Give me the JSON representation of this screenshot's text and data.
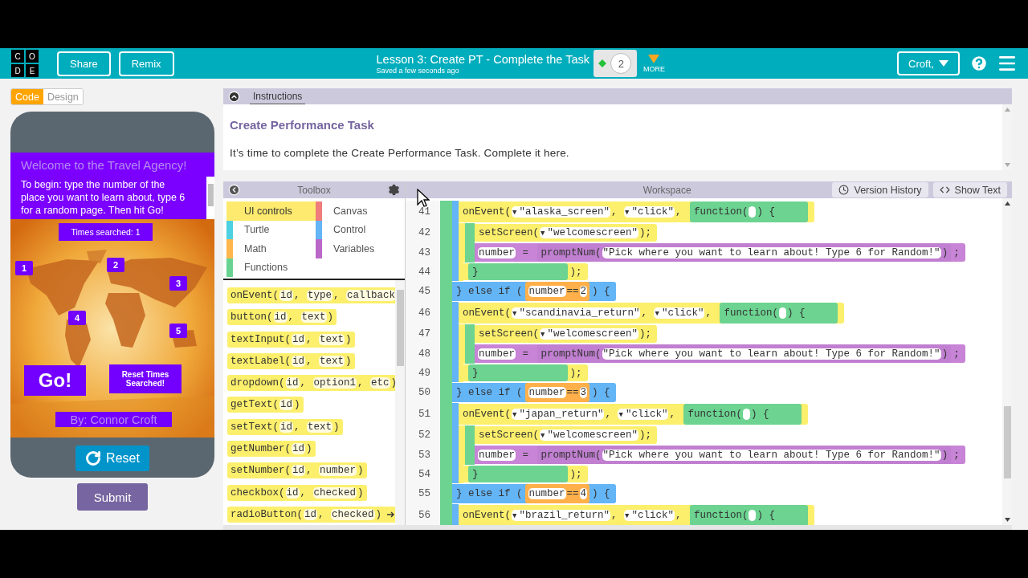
{
  "header": {
    "logo": [
      "C",
      "O",
      "D",
      "E"
    ],
    "buttons": [
      "Share",
      "Remix"
    ],
    "title": "Lesson 3: Create PT - Complete the Task",
    "saved": "Saved a few seconds ago",
    "progress": "2",
    "more": "MORE",
    "user": "Croft,"
  },
  "mode_tabs": [
    {
      "label": "Code",
      "selected": true
    },
    {
      "label": "Design",
      "selected": false
    }
  ],
  "app_screen": {
    "title": "Welcome to the Travel Agency!",
    "intro": "To begin: type the number of the place you want to learn about, type 6 for a random page. Then hit Go!",
    "counter": "Times searched: 1",
    "markers": [
      "1",
      "2",
      "3",
      "4",
      "5"
    ],
    "go": "Go!",
    "reset_count": "Reset Times Searched!",
    "author": "By: Connor Croft"
  },
  "reset": "Reset",
  "submit": "Submit",
  "instructions": {
    "tab": "Instructions",
    "heading": "Create Performance Task",
    "text": "It’s time to complete the Create Performance Task. Complete it here."
  },
  "toolbox": {
    "title": "Toolbox",
    "categories": [
      {
        "label": "UI controls",
        "color": "#fdea6e",
        "selected": true
      },
      {
        "label": "Canvas",
        "color": "#f07c7c",
        "selected": false
      },
      {
        "label": "Turtle",
        "color": "#4dd0e1",
        "selected": false
      },
      {
        "label": "Control",
        "color": "#64b5f6",
        "selected": false
      },
      {
        "label": "Math",
        "color": "#ffb74d",
        "selected": false
      },
      {
        "label": "Variables",
        "color": "#ba68c8",
        "selected": false
      },
      {
        "label": "Functions",
        "color": "#68d391",
        "selected": false
      }
    ],
    "separator": ", ",
    "blocks": [
      {
        "name": "onEvent(",
        "params": [
          "id",
          "type",
          "callback"
        ]
      },
      {
        "name": "button(",
        "params": [
          "id",
          "text"
        ],
        "close": ")"
      },
      {
        "name": "textInput(",
        "params": [
          "id",
          "text"
        ],
        "close": ")"
      },
      {
        "name": "textLabel(",
        "params": [
          "id",
          "text"
        ],
        "close": ")"
      },
      {
        "name": "dropdown(",
        "params": [
          "id",
          "option1",
          "etc"
        ],
        "close": ")"
      },
      {
        "name": "getText(",
        "params": [
          "id"
        ],
        "close": ")"
      },
      {
        "name": "setText(",
        "params": [
          "id",
          "text"
        ],
        "close": ")"
      },
      {
        "name": "getNumber(",
        "params": [
          "id"
        ],
        "close": ")"
      },
      {
        "name": "setNumber(",
        "params": [
          "id",
          "number"
        ],
        "close": ")"
      },
      {
        "name": "checkbox(",
        "params": [
          "id",
          "checked"
        ],
        "close": ")"
      },
      {
        "name": "radioButton(",
        "params": [
          "id",
          "checked"
        ],
        "close": ")",
        "more": true
      }
    ]
  },
  "workspace": {
    "title": "Workspace",
    "buttons": [
      "Version History",
      "Show Text"
    ],
    "lines": [
      {
        "num": "41",
        "kind": "event",
        "parts": [
          {
            "kind": "text",
            "text": "onEvent("
          },
          {
            "kind": "dropdown",
            "arrow": "▼",
            "text": "\"alaska_screen\""
          },
          {
            "kind": "text",
            "text": ", "
          },
          {
            "kind": "dropdown",
            "arrow": "▼",
            "text": "\"click\""
          },
          {
            "kind": "text",
            "text": ", "
          },
          {
            "kind": "function",
            "parts": [
              {
                "kind": "text",
                "text": "function("
              },
              {
                "kind": "param"
              },
              {
                "kind": "text",
                "text": ") {"
              }
            ]
          }
        ]
      },
      {
        "num": "42",
        "kind": "call",
        "parts": [
          {
            "kind": "text",
            "text": "setScreen("
          },
          {
            "kind": "dropdown",
            "arrow": "▼",
            "text": "\"welcomescreen\""
          },
          {
            "kind": "text",
            "text": ");"
          }
        ]
      },
      {
        "num": "43",
        "kind": "assign",
        "parts": [
          {
            "kind": "slot",
            "text": "number"
          },
          {
            "kind": "text",
            "text": " = "
          },
          {
            "kind": "call",
            "parts": [
              {
                "kind": "text",
                "text": "promptNum("
              },
              {
                "kind": "slot",
                "text": "\"Pick where you want to learn about! Type 6 for Random!\""
              },
              {
                "kind": "text",
                "text": ")"
              }
            ]
          },
          {
            "kind": "text",
            "text": ";"
          }
        ]
      },
      {
        "num": "44",
        "kind": "end",
        "parts": [
          {
            "kind": "function",
            "parts": [
              {
                "kind": "text",
                "text": "}"
              }
            ]
          },
          {
            "kind": "text",
            "text": ");"
          }
        ]
      },
      {
        "num": "45",
        "kind": "elseif",
        "parts": [
          {
            "kind": "text",
            "text": "} else if ("
          },
          {
            "kind": "compare",
            "parts": [
              {
                "kind": "slot",
                "text": "number"
              },
              {
                "kind": "text",
                "text": "=="
              },
              {
                "kind": "slot",
                "text": "2"
              }
            ]
          },
          {
            "kind": "text",
            "text": ") {"
          }
        ]
      },
      {
        "num": "46",
        "kind": "event",
        "parts": [
          {
            "kind": "text",
            "text": "onEvent("
          },
          {
            "kind": "dropdown",
            "arrow": "▼",
            "text": "\"scandinavia_return\""
          },
          {
            "kind": "text",
            "text": ", "
          },
          {
            "kind": "dropdown",
            "arrow": "▼",
            "text": "\"click\""
          },
          {
            "kind": "text",
            "text": ", "
          },
          {
            "kind": "function",
            "parts": [
              {
                "kind": "text",
                "text": "function("
              },
              {
                "kind": "param"
              },
              {
                "kind": "text",
                "text": ") {"
              }
            ]
          }
        ]
      },
      {
        "num": "47",
        "kind": "call",
        "parts": [
          {
            "kind": "text",
            "text": "setScreen("
          },
          {
            "kind": "dropdown",
            "arrow": "▼",
            "text": "\"welcomescreen\""
          },
          {
            "kind": "text",
            "text": ");"
          }
        ]
      },
      {
        "num": "48",
        "kind": "assign",
        "parts": [
          {
            "kind": "slot",
            "text": "number"
          },
          {
            "kind": "text",
            "text": " = "
          },
          {
            "kind": "call",
            "parts": [
              {
                "kind": "text",
                "text": "promptNum("
              },
              {
                "kind": "slot",
                "text": "\"Pick where you want to learn about! Type 6 for Random!\""
              },
              {
                "kind": "text",
                "text": ")"
              }
            ]
          },
          {
            "kind": "text",
            "text": ";"
          }
        ]
      },
      {
        "num": "49",
        "kind": "end",
        "parts": [
          {
            "kind": "function",
            "parts": [
              {
                "kind": "text",
                "text": "}"
              }
            ]
          },
          {
            "kind": "text",
            "text": ");"
          }
        ]
      },
      {
        "num": "50",
        "kind": "elseif",
        "parts": [
          {
            "kind": "text",
            "text": "} else if ("
          },
          {
            "kind": "compare",
            "parts": [
              {
                "kind": "slot",
                "text": "number"
              },
              {
                "kind": "text",
                "text": "=="
              },
              {
                "kind": "slot",
                "text": "3"
              }
            ]
          },
          {
            "kind": "text",
            "text": ") {"
          }
        ]
      },
      {
        "num": "51",
        "kind": "event",
        "parts": [
          {
            "kind": "text",
            "text": "onEvent("
          },
          {
            "kind": "dropdown",
            "arrow": "▼",
            "text": "\"japan_return\""
          },
          {
            "kind": "text",
            "text": ", "
          },
          {
            "kind": "dropdown",
            "arrow": "▼",
            "text": "\"click\""
          },
          {
            "kind": "text",
            "text": ", "
          },
          {
            "kind": "function",
            "parts": [
              {
                "kind": "text",
                "text": "function("
              },
              {
                "kind": "param"
              },
              {
                "kind": "text",
                "text": ") {"
              }
            ]
          }
        ]
      },
      {
        "num": "52",
        "kind": "call",
        "parts": [
          {
            "kind": "text",
            "text": "setScreen("
          },
          {
            "kind": "dropdown",
            "arrow": "▼",
            "text": "\"welcomescreen\""
          },
          {
            "kind": "text",
            "text": ");"
          }
        ]
      },
      {
        "num": "53",
        "kind": "assign",
        "parts": [
          {
            "kind": "slot",
            "text": "number"
          },
          {
            "kind": "text",
            "text": " = "
          },
          {
            "kind": "call",
            "parts": [
              {
                "kind": "text",
                "text": "promptNum("
              },
              {
                "kind": "slot",
                "text": "\"Pick where you want to learn about! Type 6 for Random!\""
              },
              {
                "kind": "text",
                "text": ")"
              }
            ]
          },
          {
            "kind": "text",
            "text": ";"
          }
        ]
      },
      {
        "num": "54",
        "kind": "end",
        "parts": [
          {
            "kind": "function",
            "parts": [
              {
                "kind": "text",
                "text": "}"
              }
            ]
          },
          {
            "kind": "text",
            "text": ");"
          }
        ]
      },
      {
        "num": "55",
        "kind": "elseif",
        "parts": [
          {
            "kind": "text",
            "text": "} else if ("
          },
          {
            "kind": "compare",
            "parts": [
              {
                "kind": "slot",
                "text": "number"
              },
              {
                "kind": "text",
                "text": "=="
              },
              {
                "kind": "slot",
                "text": "4"
              }
            ]
          },
          {
            "kind": "text",
            "text": ") {"
          }
        ]
      },
      {
        "num": "56",
        "kind": "event",
        "parts": [
          {
            "kind": "text",
            "text": "onEvent("
          },
          {
            "kind": "dropdown",
            "arrow": "▼",
            "text": "\"brazil_return\""
          },
          {
            "kind": "text",
            "text": ", "
          },
          {
            "kind": "dropdown",
            "arrow": "▼",
            "text": "\"click\""
          },
          {
            "kind": "text",
            "text": ", "
          },
          {
            "kind": "function",
            "parts": [
              {
                "kind": "text",
                "text": "function("
              },
              {
                "kind": "param"
              },
              {
                "kind": "text",
                "text": ") {"
              }
            ]
          }
        ]
      }
    ]
  }
}
